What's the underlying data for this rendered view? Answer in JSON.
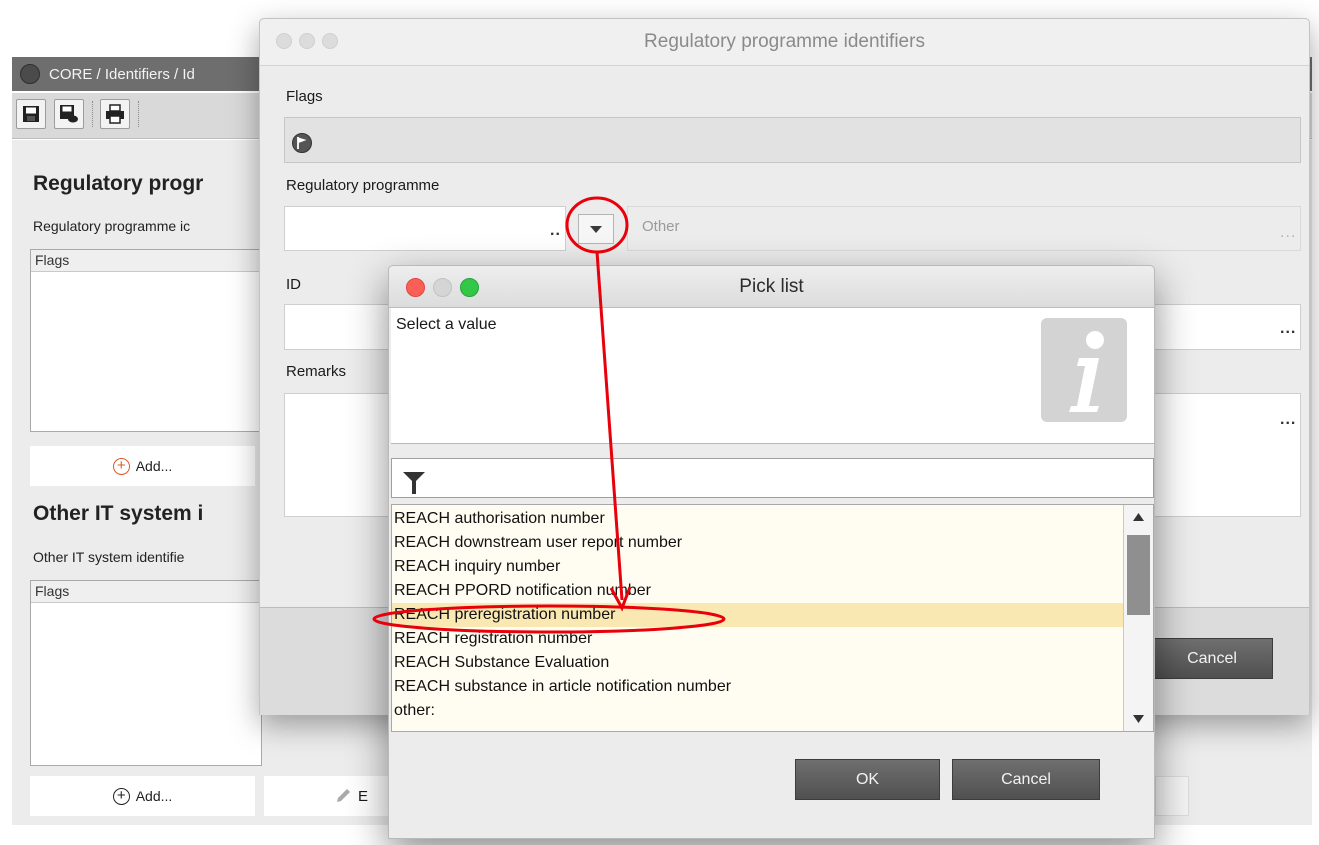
{
  "app": {
    "breadcrumb": "CORE / Identifiers / Id",
    "section1_title": "Regulatory progr",
    "section1_subtitle": "Regulatory programme ic",
    "table1_header": "Flags",
    "add1_label": "Add...",
    "section2_title": "Other IT system i",
    "section2_subtitle": "Other IT system identifie",
    "table2_header": "Flags",
    "add2_label": "Add...",
    "edit2_label": "E"
  },
  "dialog": {
    "title": "Regulatory programme identifiers",
    "flags_label": "Flags",
    "regprog_label": "Regulatory programme",
    "regprog_value": "",
    "regprog_dots": "..",
    "other_placeholder": "Other",
    "other_dots": "...",
    "id_label": "ID",
    "id_dots": "...",
    "remarks_label": "Remarks",
    "remarks_dots": "...",
    "cancel_label": "Cancel"
  },
  "picklist": {
    "title": "Pick list",
    "message": "Select a value",
    "filter_value": "",
    "items": [
      "REACH authorisation number",
      "REACH downstream user report number",
      "REACH inquiry number",
      "REACH PPORD notification number",
      "REACH preregistration number",
      "REACH registration number",
      "REACH Substance Evaluation",
      "REACH substance in article notification number",
      "other:"
    ],
    "selected_index": 4,
    "ok_label": "OK",
    "cancel_label": "Cancel"
  },
  "colors": {
    "annotation": "#e8000b",
    "selection": "#f9e8b2",
    "add_accent": "#e06a3a"
  }
}
